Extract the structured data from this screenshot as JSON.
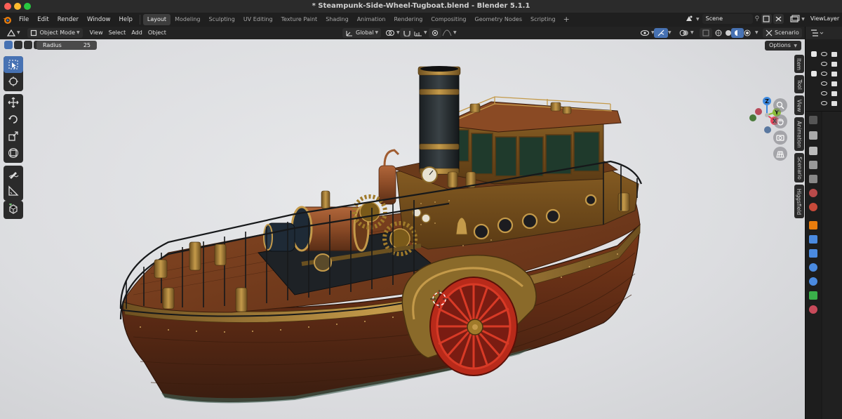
{
  "window": {
    "title": "* Steampunk-Side-Wheel-Tugboat.blend - Blender 5.1.1"
  },
  "menu": {
    "file": "File",
    "edit": "Edit",
    "render": "Render",
    "window": "Window",
    "help": "Help"
  },
  "workspaces": [
    "Layout",
    "Modeling",
    "Sculpting",
    "UV Editing",
    "Texture Paint",
    "Shading",
    "Animation",
    "Rendering",
    "Compositing",
    "Geometry Nodes",
    "Scripting"
  ],
  "workspace_add": "+",
  "scene": {
    "scene_name": "Scene",
    "view_layer": "ViewLayer"
  },
  "header": {
    "mode": "Object Mode",
    "view": "View",
    "select": "Select",
    "add": "Add",
    "object": "Object",
    "orientation": "Global",
    "scenario_btn": "Scenario"
  },
  "tool_settings": {
    "radius_label": "Radius",
    "radius_value": "25",
    "options_label": "Options"
  },
  "npanel_tabs": [
    "Item",
    "Tool",
    "View",
    "Animation",
    "Scenario",
    "Higgsfield"
  ],
  "colors": {
    "accent": "#4772b3",
    "axis_x": "#e8445a",
    "axis_y": "#8bbd3a",
    "axis_z": "#3d8ae0"
  },
  "gizmo": {
    "x_label": "X",
    "y_label": "Y",
    "z_label": "Z"
  },
  "left_tools": [
    "select-box-icon",
    "cursor-icon",
    "move-icon",
    "rotate-icon",
    "scale-icon",
    "transform-icon",
    "annotate-icon",
    "measure-icon",
    "add-cube-icon"
  ]
}
